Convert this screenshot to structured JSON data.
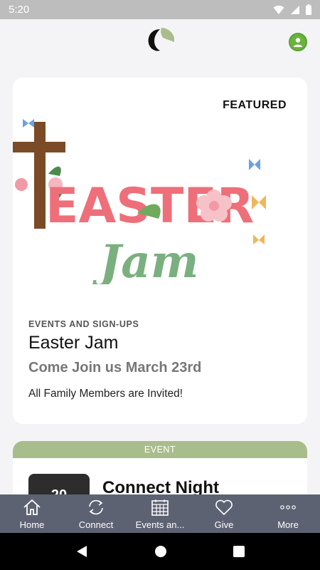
{
  "status": {
    "time": "5:20"
  },
  "featured_card": {
    "badge": "FEATURED",
    "art_text": {
      "line1": "EASTER",
      "line2": "Jam"
    },
    "category": "EVENTS AND SIGN-UPS",
    "title": "Easter Jam",
    "subtitle": "Come Join us March 23rd",
    "description": "All Family Members are Invited!"
  },
  "event_card": {
    "banner": "EVENT",
    "thumb_text": "20",
    "title": "Connect Night"
  },
  "tabbar": {
    "items": [
      {
        "label": "Home",
        "icon": "home-icon"
      },
      {
        "label": "Connect",
        "icon": "sync-icon"
      },
      {
        "label": "Events an...",
        "icon": "calendar-icon"
      },
      {
        "label": "Give",
        "icon": "heart-icon"
      },
      {
        "label": "More",
        "icon": "more-dots-icon"
      }
    ]
  },
  "colors": {
    "header_bg": "#f4f4f6",
    "tabbar_bg": "#5d6273",
    "event_banner": "#a9bd8c",
    "avatar": "#6cb33e",
    "easter_pink": "#ee6f7a",
    "jam_green": "#7ab07f"
  }
}
